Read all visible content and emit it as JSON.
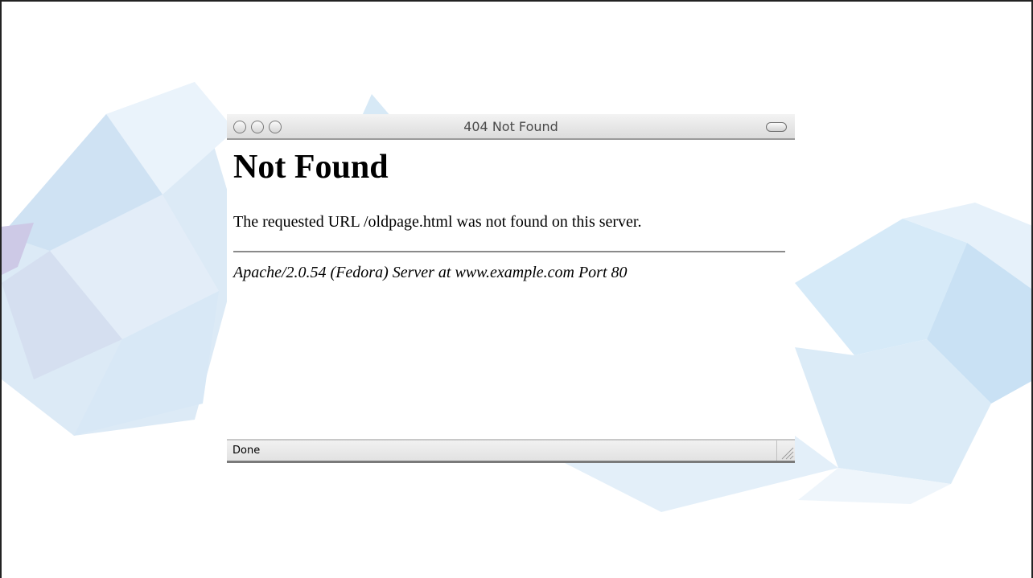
{
  "window": {
    "title": "404 Not Found"
  },
  "page": {
    "heading": "Not Found",
    "message": "The requested URL /oldpage.html was not found on this server.",
    "server_signature": "Apache/2.0.54 (Fedora) Server at www.example.com Port 80"
  },
  "statusbar": {
    "status": "Done"
  },
  "icons": [
    "close-icon",
    "minimize-icon",
    "zoom-icon",
    "toolbar-toggle-icon",
    "resize-grip-icon"
  ],
  "colors": {
    "background_art": "#cfe3f5",
    "titlebar": "#e6e6e6",
    "rule": "#8a8a8a"
  }
}
